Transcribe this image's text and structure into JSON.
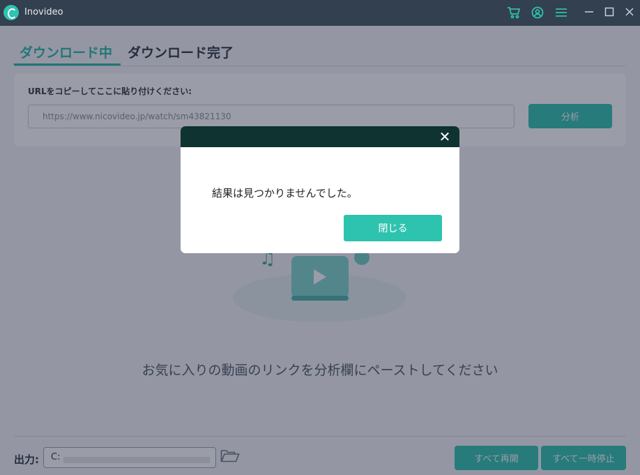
{
  "titlebar": {
    "app_title": "Inovideo",
    "icons": [
      "cart-icon",
      "user-icon",
      "menu-icon"
    ],
    "window_controls": [
      "minimize",
      "maximize",
      "close"
    ]
  },
  "tabs": [
    {
      "label": "ダウンロード中",
      "active": true
    },
    {
      "label": "ダウンロード完了",
      "active": false
    }
  ],
  "url_panel": {
    "label": "URLをコピーしてここに貼り付けください:",
    "input_value": "https://www.nicovideo.jp/watch/sm43821130",
    "analyze_label": "分析"
  },
  "empty_state": {
    "hint": "お気に入りの動画のリンクを分析欄にペーストしてください"
  },
  "bottom_bar": {
    "output_label": "出力:",
    "output_path": "C:",
    "resume_all_label": "すべて再開",
    "pause_all_label": "すべて一時停止"
  },
  "dialog": {
    "message": "結果は見つかりませんでした。",
    "close_button_label": "閉じる"
  },
  "colors": {
    "accent": "#2fc3b0",
    "titlebar": "#33404f",
    "dialog_header": "#0e3330"
  }
}
